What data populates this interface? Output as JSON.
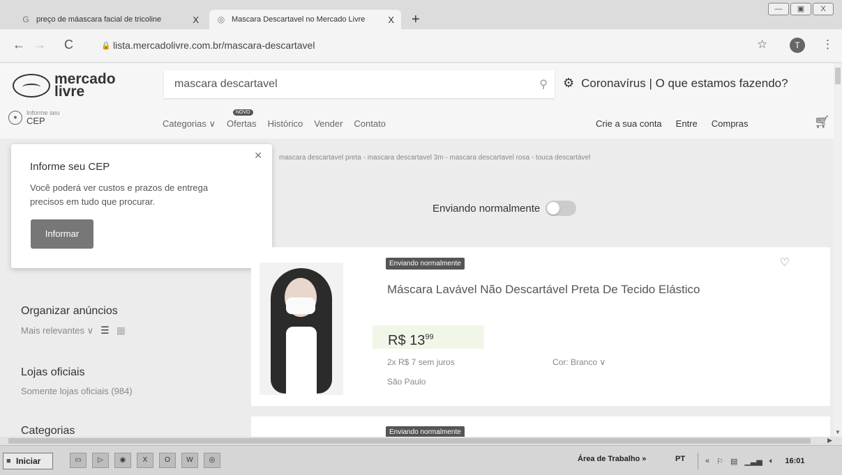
{
  "browser": {
    "tabs": [
      {
        "label": "preço de máascara facial de tricoline",
        "close": "X"
      },
      {
        "label": "Mascara Descartavel no Mercado Livre",
        "close": "X"
      }
    ],
    "new_tab": "+",
    "url": "lista.mercadolivre.com.br/mascara-descartavel",
    "profile_initial": "T",
    "window_controls": [
      "—",
      "▣",
      "X"
    ]
  },
  "header": {
    "logo_line1": "mercado",
    "logo_line2": "livre",
    "search_value": "mascara descartavel",
    "promo_text": "Coronavírus | O que estamos fazendo?",
    "cep_small": "Informe seu",
    "cep_big": "CEP",
    "nav": {
      "categories": "Categorias ∨",
      "new_badge": "NOVO",
      "offers": "Ofertas",
      "history": "Histórico",
      "sell": "Vender",
      "contact": "Contato"
    },
    "user": {
      "create_account": "Crie a sua conta",
      "login": "Entre",
      "purchases": "Compras"
    }
  },
  "related_searches": "mascara descartavel preta  -  mascara descartavel 3m  -  mascara descartavel rosa  -  touca descartável",
  "filter_toggle": "Enviando normalmente",
  "cep_popup": {
    "title": "Informe seu CEP",
    "body": "Você poderá ver custos e prazos de entrega precisos em tudo que procurar.",
    "button": "Informar"
  },
  "sidebar": {
    "sort_title": "Organizar anúncios",
    "sort_value": "Mais relevantes ∨",
    "stores_title": "Lojas oficiais",
    "stores_value": "Somente lojas oficiais (984)",
    "categories_title": "Categorias"
  },
  "result": {
    "badge": "Enviando normalmente",
    "title": "Máscara Lavável Não Descartável Preta De Tecido Elástico",
    "price_main": "R$ 13",
    "price_cents": "99",
    "installments": "2x R$ 7 sem juros",
    "color": "Cor: Branco ∨",
    "city": "São Paulo"
  },
  "result2": {
    "badge": "Enviando normalmente"
  },
  "taskbar": {
    "start": "Iniciar",
    "desktop": "Área de Trabalho »",
    "lang": "PT",
    "clock": "16:01"
  }
}
